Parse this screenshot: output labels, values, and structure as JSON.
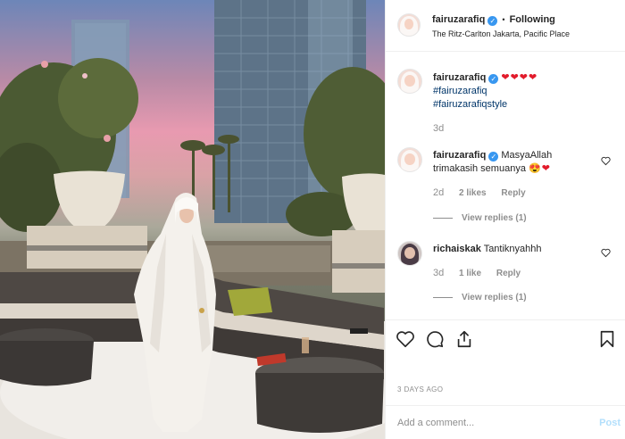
{
  "header": {
    "username": "fairuzarafiq",
    "separator": "•",
    "follow_status": "Following",
    "location": "The Ritz-Carlton Jakarta, Pacific Place"
  },
  "caption": {
    "username": "fairuzarafiq",
    "hearts": "❤❤❤❤",
    "tags": [
      "#fairuzarafiq",
      "#fairuzarafiqstyle"
    ],
    "age": "3d"
  },
  "comments": [
    {
      "username": "fairuzarafiq",
      "text": "MasyaAllah trimakasih semuanya",
      "emoji": "😍❤",
      "age": "2d",
      "likes": "2 likes",
      "reply_label": "Reply",
      "view_replies": "View replies (1)"
    },
    {
      "username": "richaiskak",
      "text": "Tantiknyahhh",
      "age": "3d",
      "likes": "1 like",
      "reply_label": "Reply",
      "view_replies": "View replies (1)"
    }
  ],
  "post_date": "3 DAYS AGO",
  "add_comment": {
    "placeholder": "Add a comment...",
    "post_label": "Post"
  },
  "colors": {
    "link_blue": "#003569",
    "verified_blue": "#3897f0",
    "heart_red": "#e21b2b",
    "muted_gray": "#8e8e8e",
    "post_disabled": "#b2dffc"
  }
}
